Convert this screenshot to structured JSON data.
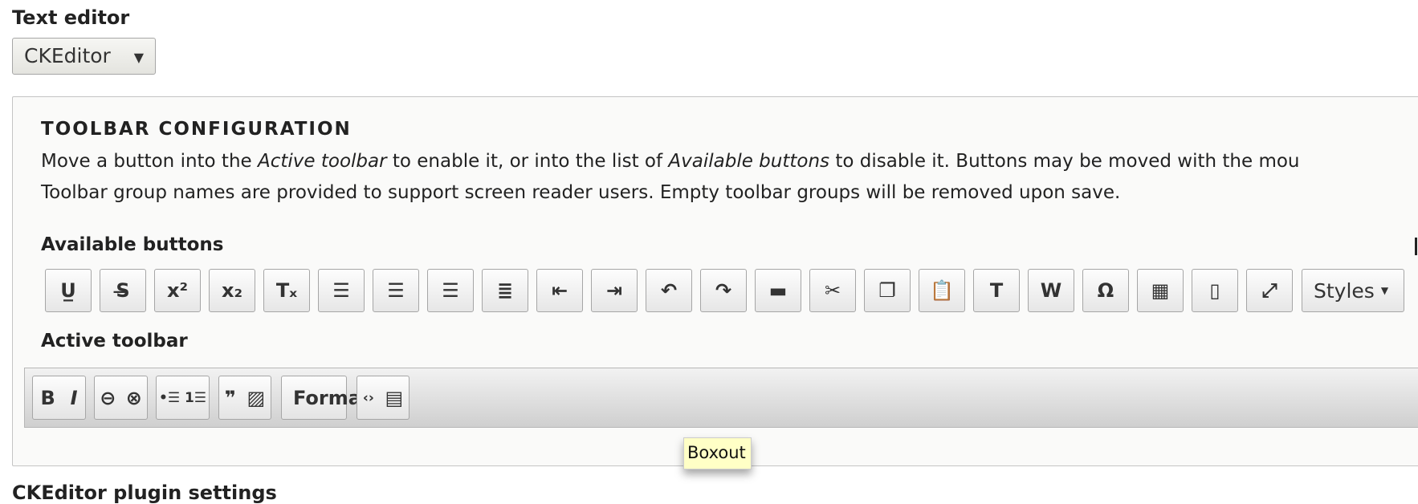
{
  "text_editor": {
    "label": "Text editor",
    "value": "CKEditor"
  },
  "toolbar_config": {
    "heading": "TOOLBAR CONFIGURATION",
    "desc1_a": "Move a button into the ",
    "desc1_em1": "Active toolbar",
    "desc1_b": " to enable it, or into the list of ",
    "desc1_em2": "Available buttons",
    "desc1_c": " to disable it. Buttons may be moved with the mou",
    "desc2": "Toolbar group names are provided to support screen reader users. Empty toolbar groups will be removed upon save.",
    "available_label": "Available buttons",
    "available": [
      {
        "icon": "underline-icon",
        "glyph": "U̲"
      },
      {
        "icon": "strikethrough-icon",
        "glyph": "S̶"
      },
      {
        "icon": "superscript-icon",
        "glyph": "x²"
      },
      {
        "icon": "subscript-icon",
        "glyph": "x₂"
      },
      {
        "icon": "remove-format-icon",
        "glyph": "Tₓ"
      },
      {
        "icon": "align-left-icon",
        "glyph": "☰"
      },
      {
        "icon": "align-center-icon",
        "glyph": "☰"
      },
      {
        "icon": "align-right-icon",
        "glyph": "☰"
      },
      {
        "icon": "justify-icon",
        "glyph": "≣"
      },
      {
        "icon": "outdent-icon",
        "glyph": "⇤"
      },
      {
        "icon": "indent-icon",
        "glyph": "⇥"
      },
      {
        "icon": "undo-icon",
        "glyph": "↶"
      },
      {
        "icon": "redo-icon",
        "glyph": "↷"
      },
      {
        "icon": "horizontal-line-icon",
        "glyph": "▬"
      },
      {
        "icon": "cut-icon",
        "glyph": "✂"
      },
      {
        "icon": "copy-icon",
        "glyph": "❐"
      },
      {
        "icon": "paste-icon",
        "glyph": "📋"
      },
      {
        "icon": "paste-text-icon",
        "glyph": "T"
      },
      {
        "icon": "paste-word-icon",
        "glyph": "W"
      },
      {
        "icon": "special-character-icon",
        "glyph": "Ω"
      },
      {
        "icon": "table-icon",
        "glyph": "▦"
      },
      {
        "icon": "show-blocks-icon",
        "glyph": "▯"
      },
      {
        "icon": "maximize-icon",
        "glyph": "⤢"
      }
    ],
    "styles_label": "Styles",
    "active_label": "Active toolbar",
    "active_groups": [
      [
        {
          "icon": "bold-icon",
          "glyph": "B"
        },
        {
          "icon": "italic-icon",
          "glyph": "I"
        }
      ],
      [
        {
          "icon": "link-icon",
          "glyph": "⊖"
        },
        {
          "icon": "unlink-icon",
          "glyph": "⊗"
        }
      ],
      [
        {
          "icon": "bulleted-list-icon",
          "glyph": "•☰"
        },
        {
          "icon": "numbered-list-icon",
          "glyph": "1☰"
        }
      ],
      [
        {
          "icon": "blockquote-icon",
          "glyph": "❞"
        },
        {
          "icon": "image-icon",
          "glyph": "▨"
        }
      ],
      [
        {
          "icon": "source-icon",
          "glyph": "‹›"
        },
        {
          "icon": "boxout-icon",
          "glyph": "▤"
        }
      ]
    ],
    "format_label": "Format",
    "tooltip": "Boxout"
  },
  "next_section": "CKEditor plugin settings"
}
